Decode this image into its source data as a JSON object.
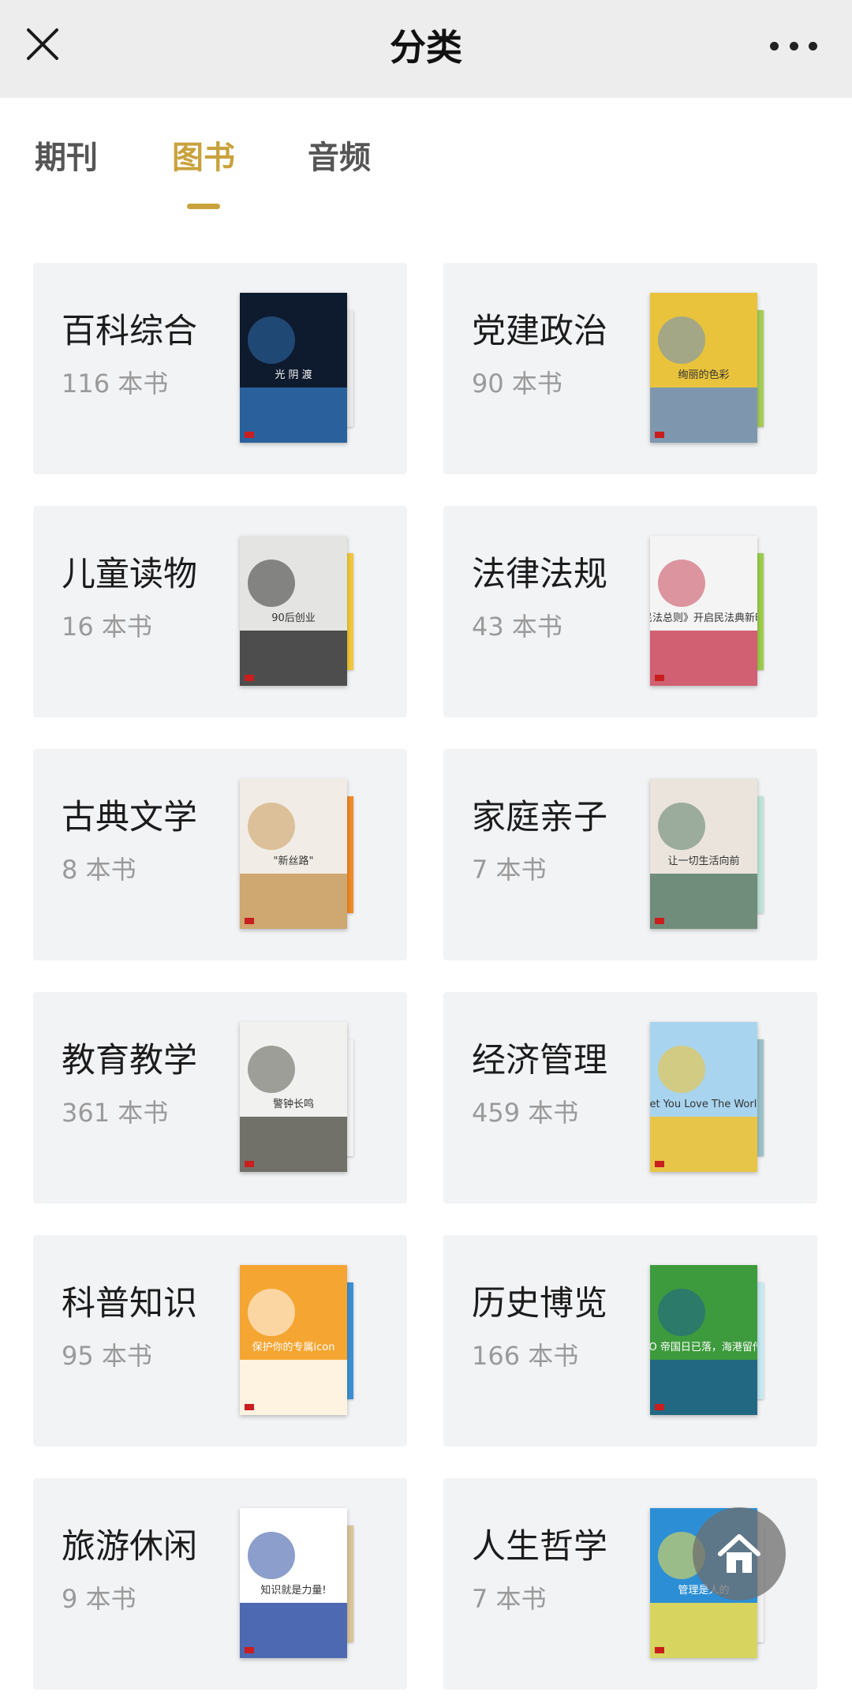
{
  "header": {
    "title": "分类"
  },
  "tabs": [
    {
      "label": "期刊"
    },
    {
      "label": "图书"
    },
    {
      "label": "音频"
    }
  ],
  "active_tab": "图书",
  "accent_color": "#c9a23d",
  "categories": [
    {
      "name": "百科综合",
      "count": "116 本书",
      "cover_text": "光 阴 渡",
      "cover_bg": "#0e1a2e",
      "cover_accent": "#2f6fb0",
      "back_color": "#e8e8e8"
    },
    {
      "name": "党建政治",
      "count": "90 本书",
      "cover_text": "绚丽的色彩",
      "cover_bg": "#e9c33c",
      "cover_accent": "#6c8fc2",
      "back_color": "#a7cc5a"
    },
    {
      "name": "儿童读物",
      "count": "16 本书",
      "cover_text": "90后创业",
      "cover_bg": "#e4e4e2",
      "cover_accent": "#333333",
      "back_color": "#f0c83a"
    },
    {
      "name": "法律法规",
      "count": "43 本书",
      "cover_text": "《民法总则》开启民法典新时代",
      "cover_bg": "#f4f4f4",
      "cover_accent": "#c9455a",
      "back_color": "#9ccc4a"
    },
    {
      "name": "古典文学",
      "count": "8 本书",
      "cover_text": "\"新丝路\"",
      "cover_bg": "#f1ede6",
      "cover_accent": "#c99a5a",
      "back_color": "#f08a2a"
    },
    {
      "name": "家庭亲子",
      "count": "7 本书",
      "cover_text": "让一切生活向前",
      "cover_bg": "#eae4dc",
      "cover_accent": "#5a7e6a",
      "back_color": "#bfe3d8"
    },
    {
      "name": "教育教学",
      "count": "361 本书",
      "cover_text": "警钟长鸣",
      "cover_bg": "#f1f1ef",
      "cover_accent": "#5a5a52",
      "back_color": "#f2f2f2"
    },
    {
      "name": "经济管理",
      "count": "459 本书",
      "cover_text": "Let You Love The World",
      "cover_bg": "#a9d4ef",
      "cover_accent": "#f2c22c",
      "back_color": "#9ac0c8"
    },
    {
      "name": "科普知识",
      "count": "95 本书",
      "cover_text": "保护你的专属icon",
      "cover_bg": "#f5a531",
      "cover_accent": "#ffffff",
      "back_color": "#3d8fd1"
    },
    {
      "name": "历史博览",
      "count": "166 本书",
      "cover_text": "GEO 帝国日已落，海港留传说",
      "cover_bg": "#3d9b3d",
      "cover_accent": "#1e5f8f",
      "back_color": "#c7e9f2"
    },
    {
      "name": "旅游休闲",
      "count": "9 本书",
      "cover_text": "知识就是力量!",
      "cover_bg": "#ffffff",
      "cover_accent": "#2d4fa3",
      "back_color": "#d9c59a"
    },
    {
      "name": "人生哲学",
      "count": "7 本书",
      "cover_text": "管理是人的",
      "cover_bg": "#2c8fd6",
      "cover_accent": "#f6e24a",
      "back_color": "#f2f2f2"
    }
  ]
}
